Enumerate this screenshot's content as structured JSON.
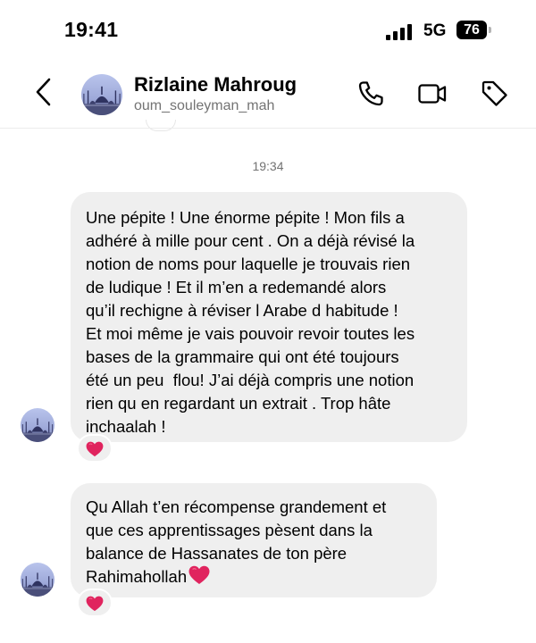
{
  "status_bar": {
    "time": "19:41",
    "network": "5G",
    "battery": "76"
  },
  "header": {
    "name": "Rizlaine Mahroug",
    "username": "oum_souleyman_mah",
    "icons": [
      "back-chevron-icon",
      "phone-icon",
      "video-camera-icon",
      "tag-icon"
    ]
  },
  "thread": {
    "timestamp": "19:34",
    "messages": [
      {
        "lines": [
          "Une pépite ! Une énorme pépite ! Mon fils a",
          "adhéré à mille pour cent . On a déjà révisé la",
          "notion de noms pour laquelle je trouvais rien",
          "de ludique ! Et il m’en a redemandé alors",
          "qu’il rechigne à réviser l Arabe d habitude !",
          "Et moi même je vais pouvoir revoir toutes les",
          "bases de la grammaire qui ont été toujours",
          "été un peu  flou! J’ai déjà compris une notion",
          "rien qu en regardant un extrait . Trop hâte",
          "inchaalah !"
        ],
        "reaction": "heart"
      },
      {
        "lines": [
          "Qu Allah t’en récompense grandement et",
          "que ces apprentissages pèsent dans la",
          "balance de Hassanates de ton père",
          "Rahimahollah"
        ],
        "trailing_emoji": "heart",
        "reaction": "heart"
      }
    ]
  },
  "colors": {
    "bubble": "#efefef",
    "heart": "#e0245e",
    "secondary_text": "#737373"
  }
}
